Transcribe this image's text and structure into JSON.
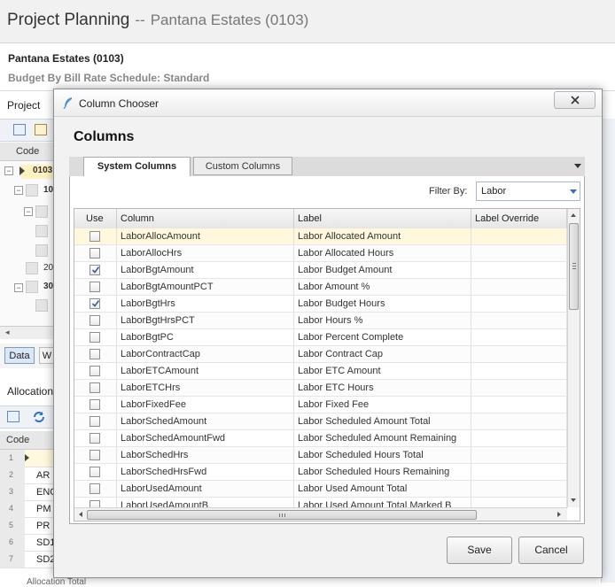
{
  "app": {
    "title": "Project Planning",
    "title_separator": "--",
    "project_header": "Pantana Estates  (0103)",
    "project_name": "Pantana Estates (0103)",
    "budget_line": "Budget By Bill Rate Schedule: Standard",
    "project_tab": "Project",
    "code_header": "Code",
    "tree_rows": [
      "0103",
      "10",
      "20",
      "30"
    ],
    "data_button": "Data",
    "w_button": "W",
    "allocation_label": "Allocation",
    "code_header_2": "Code",
    "bottom_text": "Allocation Total",
    "lower_rows": [
      {
        "num": "1",
        "code": ""
      },
      {
        "num": "2",
        "code": "AR"
      },
      {
        "num": "3",
        "code": "ENG"
      },
      {
        "num": "4",
        "code": "PM"
      },
      {
        "num": "5",
        "code": "PR"
      },
      {
        "num": "6",
        "code": "SD1"
      },
      {
        "num": "7",
        "code": "SD2"
      }
    ]
  },
  "dialog": {
    "title": "Column Chooser",
    "heading": "Columns",
    "tabs": [
      "System Columns",
      "Custom Columns"
    ],
    "filter_label": "Filter By:",
    "filter_value": "Labor",
    "columns": [
      "Use",
      "Column",
      "Label",
      "Label Override"
    ],
    "rows": [
      {
        "use": false,
        "column": "LaborAllocAmount",
        "label": "Labor Allocated Amount"
      },
      {
        "use": false,
        "column": "LaborAllocHrs",
        "label": "Labor Allocated Hours"
      },
      {
        "use": true,
        "column": "LaborBgtAmount",
        "label": "Labor Budget Amount"
      },
      {
        "use": false,
        "column": "LaborBgtAmountPCT",
        "label": "Labor Amount %"
      },
      {
        "use": true,
        "column": "LaborBgtHrs",
        "label": "Labor Budget Hours"
      },
      {
        "use": false,
        "column": "LaborBgtHrsPCT",
        "label": "Labor Hours %"
      },
      {
        "use": false,
        "column": "LaborBgtPC",
        "label": "Labor Percent Complete"
      },
      {
        "use": false,
        "column": "LaborContractCap",
        "label": "Labor Contract Cap"
      },
      {
        "use": false,
        "column": "LaborETCAmount",
        "label": "Labor ETC Amount"
      },
      {
        "use": false,
        "column": "LaborETCHrs",
        "label": "Labor ETC Hours"
      },
      {
        "use": false,
        "column": "LaborFixedFee",
        "label": "Labor Fixed Fee"
      },
      {
        "use": false,
        "column": "LaborSchedAmount",
        "label": "Labor Scheduled Amount Total"
      },
      {
        "use": false,
        "column": "LaborSchedAmountFwd",
        "label": "Labor Scheduled Amount Remaining"
      },
      {
        "use": false,
        "column": "LaborSchedHrs",
        "label": "Labor Scheduled Hours Total"
      },
      {
        "use": false,
        "column": "LaborSchedHrsFwd",
        "label": "Labor Scheduled Hours Remaining"
      },
      {
        "use": false,
        "column": "LaborUsedAmount",
        "label": "Labor Used Amount Total"
      },
      {
        "use": false,
        "column": "LaborUsedAmountB",
        "label": "Labor Used Amount Total Marked B"
      }
    ],
    "save_label": "Save",
    "cancel_label": "Cancel"
  },
  "colors": {
    "selected_row": "#fff8dc",
    "accent": "#3b6db8"
  }
}
